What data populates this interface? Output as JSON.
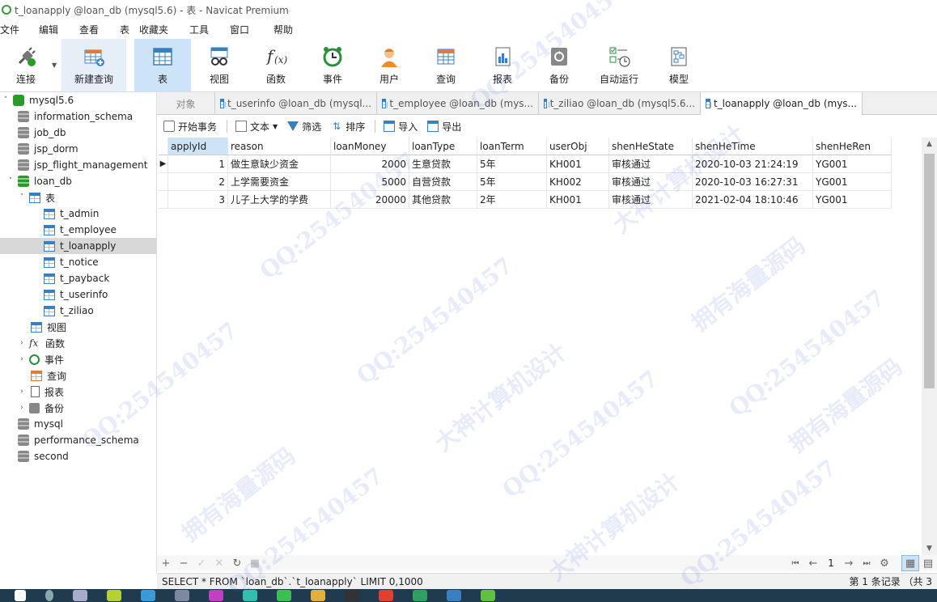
{
  "window": {
    "title": "t_loanapply @loan_db (mysql5.6) - 表 - Navicat Premium"
  },
  "menu": [
    "文件",
    "编辑",
    "查看",
    "表",
    "收藏夹",
    "工具",
    "窗口",
    "帮助"
  ],
  "toolbar": {
    "connect": "连接",
    "new_query": "新建查询",
    "buttons": [
      "表",
      "视图",
      "函数",
      "事件",
      "用户",
      "查询",
      "报表",
      "备份",
      "自动运行",
      "模型"
    ]
  },
  "sidebar": {
    "connection": "mysql5.6",
    "databases_top": [
      "information_schema",
      "job_db",
      "jsp_dorm",
      "jsp_flight_management"
    ],
    "open_db": "loan_db",
    "tables_label": "表",
    "tables": [
      "t_admin",
      "t_employee",
      "t_loanapply",
      "t_notice",
      "t_payback",
      "t_userinfo",
      "t_ziliao"
    ],
    "objects": [
      "视图",
      "函数",
      "事件",
      "查询",
      "报表",
      "备份"
    ],
    "databases_bottom": [
      "mysql",
      "performance_schema",
      "second"
    ]
  },
  "tabs": {
    "objects": "对象",
    "open": [
      "t_userinfo @loan_db (mysql...",
      "t_employee @loan_db (mys...",
      "t_ziliao @loan_db (mysql5.6...",
      "t_loanapply @loan_db (mys..."
    ]
  },
  "subtoolbar": {
    "begin": "开始事务",
    "text": "文本",
    "filter": "筛选",
    "sort": "排序",
    "import": "导入",
    "export": "导出"
  },
  "grid": {
    "columns": [
      "applyId",
      "reason",
      "loanMoney",
      "loanType",
      "loanTerm",
      "userObj",
      "shenHeState",
      "shenHeTime",
      "shenHeRen"
    ],
    "rows": [
      [
        "1",
        "做生意缺少资金",
        "2000",
        "生意贷款",
        "5年",
        "KH001",
        "审核通过",
        "2020-10-03 21:24:19",
        "YG001"
      ],
      [
        "2",
        "上学需要资金",
        "5000",
        "自营贷款",
        "5年",
        "KH002",
        "审核通过",
        "2020-10-03 16:27:31",
        "YG001"
      ],
      [
        "3",
        "儿子上大学的学费",
        "20000",
        "其他贷款",
        "2年",
        "KH001",
        "审核通过",
        "2021-02-04 18:10:46",
        "YG001"
      ]
    ]
  },
  "pager": {
    "page": "1"
  },
  "status": {
    "sql": "SELECT * FROM `loan_db`.`t_loanapply` LIMIT 0,1000",
    "records": "第 1 条记录 （共 3"
  },
  "watermarks": [
    "QQ:254540457",
    "大神计算机设计",
    "拥有海量源码"
  ]
}
